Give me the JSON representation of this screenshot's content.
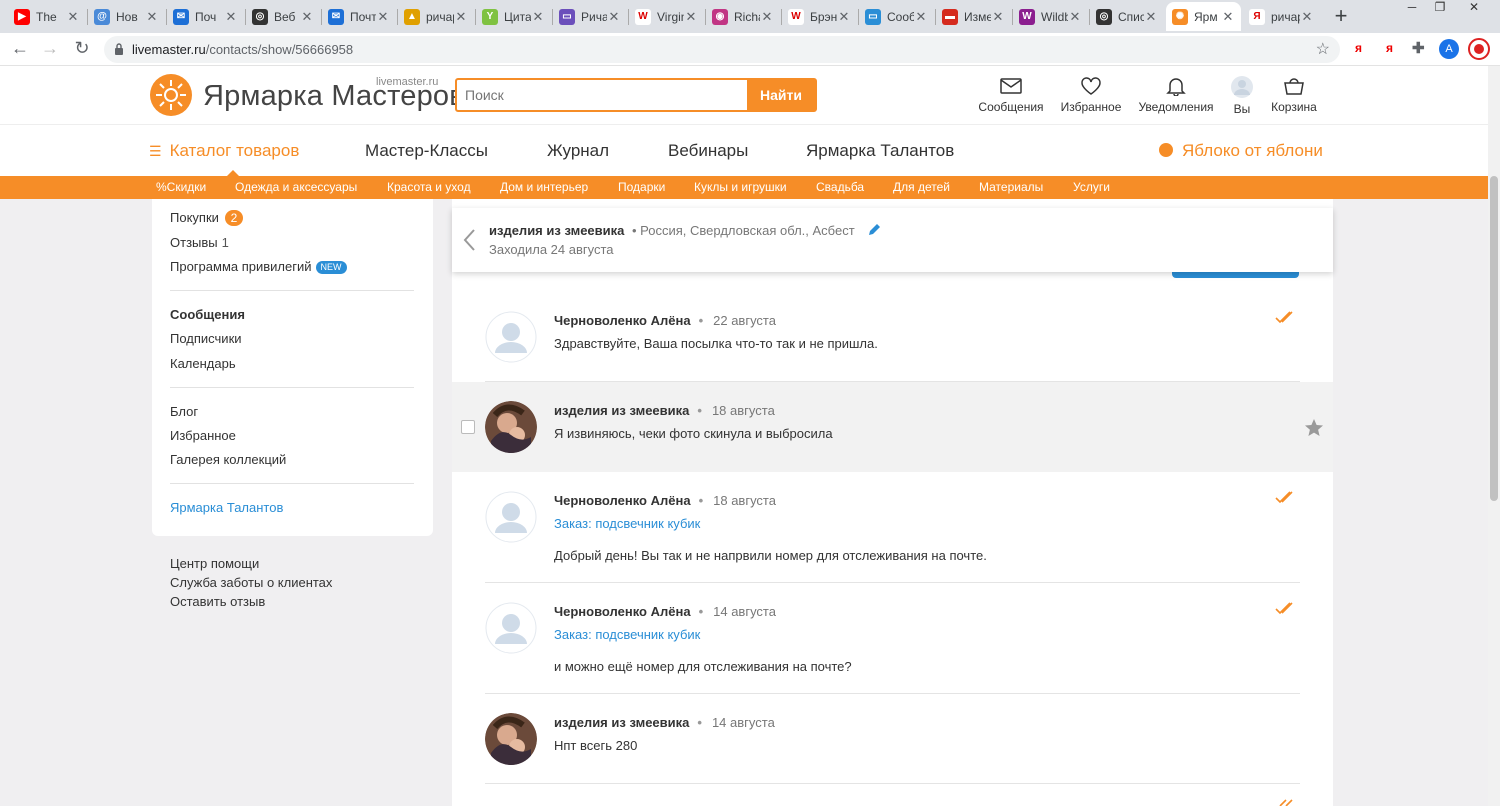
{
  "browser": {
    "tabs": [
      {
        "title": "The",
        "fav_color": "#ff0000",
        "fav_glyph": "▶"
      },
      {
        "title": "Нов",
        "fav_color": "#4a8ad8",
        "fav_glyph": "@"
      },
      {
        "title": "Поч",
        "fav_color": "#1d6fd6",
        "fav_glyph": "✉"
      },
      {
        "title": "Веб",
        "fav_color": "#333333",
        "fav_glyph": "◎"
      },
      {
        "title": "Почта",
        "fav_color": "#1d6fd6",
        "fav_glyph": "✉"
      },
      {
        "title": "ричард",
        "fav_color": "#e0a000",
        "fav_glyph": "▲"
      },
      {
        "title": "Цитаты",
        "fav_color": "#7fc241",
        "fav_glyph": "Y"
      },
      {
        "title": "Ричард",
        "fav_color": "#6b4fbb",
        "fav_glyph": "▭"
      },
      {
        "title": "Virgin G",
        "fav_color": "#ffffff",
        "fav_glyph": "W"
      },
      {
        "title": "Richard",
        "fav_color": "#c13584",
        "fav_glyph": "◉"
      },
      {
        "title": "Брэнсо",
        "fav_color": "#ffffff",
        "fav_glyph": "W"
      },
      {
        "title": "Сообщ",
        "fav_color": "#2a8ed6",
        "fav_glyph": "▭"
      },
      {
        "title": "Измене",
        "fav_color": "#d52b1e",
        "fav_glyph": "▬"
      },
      {
        "title": "Wildber",
        "fav_color": "#8b1e8f",
        "fav_glyph": "W"
      },
      {
        "title": "Список",
        "fav_color": "#333333",
        "fav_glyph": "◎"
      },
      {
        "title": "Ярм",
        "fav_color": "#f68d27",
        "fav_glyph": "✺"
      },
      {
        "title": "ричард",
        "fav_color": "#ffffff",
        "fav_glyph": "Я"
      }
    ],
    "url_domain": "livemaster.ru",
    "url_path": "/contacts/show/56666958",
    "new_tab": "+",
    "profile_initial": "A",
    "ext_ya1": "я",
    "ext_ya2": "я"
  },
  "header": {
    "logo_sub": "livemaster.ru",
    "logo_title": "Ярмарка Мастеров",
    "search_placeholder": "Поиск",
    "search_button": "Найти",
    "icons": [
      {
        "label": "Сообщения"
      },
      {
        "label": "Избранное"
      },
      {
        "label": "Уведомления"
      },
      {
        "label": "Вы"
      },
      {
        "label": "Корзина"
      }
    ]
  },
  "catnav": {
    "catalog": "Каталог товаров",
    "items": [
      "Мастер-Классы",
      "Журнал",
      "Вебинары",
      "Ярмарка Талантов"
    ],
    "promo": "Яблоко от яблони"
  },
  "categories": [
    "%Скидки",
    "Одежда и аксессуары",
    "Красота и уход",
    "Дом и интерьер",
    "Подарки",
    "Куклы и игрушки",
    "Свадьба",
    "Для детей",
    "Материалы",
    "Услуги"
  ],
  "sidebar": {
    "purchases": "Покупки",
    "purchases_count": "2",
    "reviews": "Отзывы",
    "reviews_count": "1",
    "privileges": "Программа привилегий",
    "new_badge": "NEW",
    "messages": "Сообщения",
    "subscribers": "Подписчики",
    "calendar": "Календарь",
    "blog": "Блог",
    "favorites": "Избранное",
    "gallery": "Галерея коллекций",
    "talents": "Ярмарка Талантов"
  },
  "help": {
    "center": "Центр помощи",
    "care": "Служба заботы о клиентах",
    "feedback": "Оставить отзыв"
  },
  "chat": {
    "name": "изделия из змеевика",
    "location": "• Россия, Свердловская обл., Асбест",
    "seen": "Заходила 24 августа"
  },
  "messages": [
    {
      "author": "Черноволенко Алёна",
      "date": "22 августа",
      "order": "",
      "text": "Здравствуйте, Ваша посылка что-то так и не пришла."
    },
    {
      "author": "изделия из змеевика",
      "date": "18 августа",
      "order": "",
      "text": "Я извиняюсь, чеки фото скинула и выбросила"
    },
    {
      "author": "Черноволенко Алёна",
      "date": "18 августа",
      "order": "Заказ: подсвечник кубик",
      "text": "Добрый день! Вы так и не напрвили номер для отслеживания на почте."
    },
    {
      "author": "Черноволенко Алёна",
      "date": "14 августа",
      "order": "Заказ: подсвечник кубик",
      "text": "и можно ещё номер для отслеживания на почте?"
    },
    {
      "author": "изделия из змеевика",
      "date": "14 августа",
      "order": "",
      "text": "Нпт всегь 280"
    }
  ],
  "colors": {
    "accent": "#f68d27",
    "link": "#2a8ed6"
  }
}
